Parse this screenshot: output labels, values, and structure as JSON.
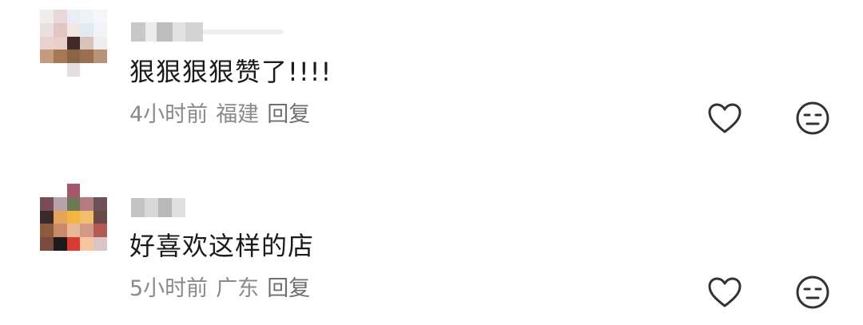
{
  "comments": [
    {
      "text": "狠狠狠狠赞了!!!!",
      "time": "4小时前",
      "location": "福建",
      "reply_label": "回复",
      "avatar_pixels": [
        [
          "#f3ecec",
          "#e8d8d8",
          "#e9eef5",
          "#eef3f8",
          "#f4f6f9"
        ],
        [
          "#eadfe0",
          "#e2c6c3",
          "#f1e7e3",
          "#e1ebf3",
          "#f1f4f7"
        ],
        [
          "#e8d1cf",
          "#e8cfc8",
          "#3f2a25",
          "#d9c3b8",
          "#eeeeee"
        ],
        [
          "#c69a7c",
          "#a87854",
          "#8a6446",
          "#9c6f50",
          "#b99377"
        ],
        [
          "#ffffff",
          "#ffffff",
          "#e4dede",
          "#ffffff",
          "#ffffff"
        ]
      ],
      "username_blocks": [
        "#c8c8c8",
        "#ececec",
        "#bdbdbd",
        "#e2e2e2",
        "#d3d3d3",
        "#eeeeee"
      ],
      "like_icon": "heart-outline-icon",
      "dislike_icon": "meh-face-icon"
    },
    {
      "text": "好喜欢这样的店",
      "time": "5小时前",
      "location": "广东",
      "reply_label": "回复",
      "avatar_pixels": [
        [
          "#ffffff",
          "#ffffff",
          "#a8566a",
          "#ffffff",
          "#ffffff"
        ],
        [
          "#7a4b56",
          "#b7a3a7",
          "#6b7a52",
          "#b47c7e",
          "#6e5058"
        ],
        [
          "#3b2a2a",
          "#e6a35a",
          "#f4b53e",
          "#f2c06a",
          "#6a4a44"
        ],
        [
          "#8c5a3c",
          "#c98a6a",
          "#e7b79a",
          "#d29a86",
          "#b35a55"
        ],
        [
          "#7a4a3a",
          "#1e1a1a",
          "#d93a32",
          "#f6c79f",
          "#d9c6c6"
        ]
      ],
      "username_blocks": [
        "#c4c4c4",
        "#d8d8d8",
        "#b9b9b9",
        "#e0e0e0"
      ],
      "like_icon": "heart-outline-icon",
      "dislike_icon": "meh-face-icon"
    }
  ],
  "colors": {
    "text": "#1b1b1b",
    "meta": "#8a8a8a",
    "icon": "#333333"
  }
}
